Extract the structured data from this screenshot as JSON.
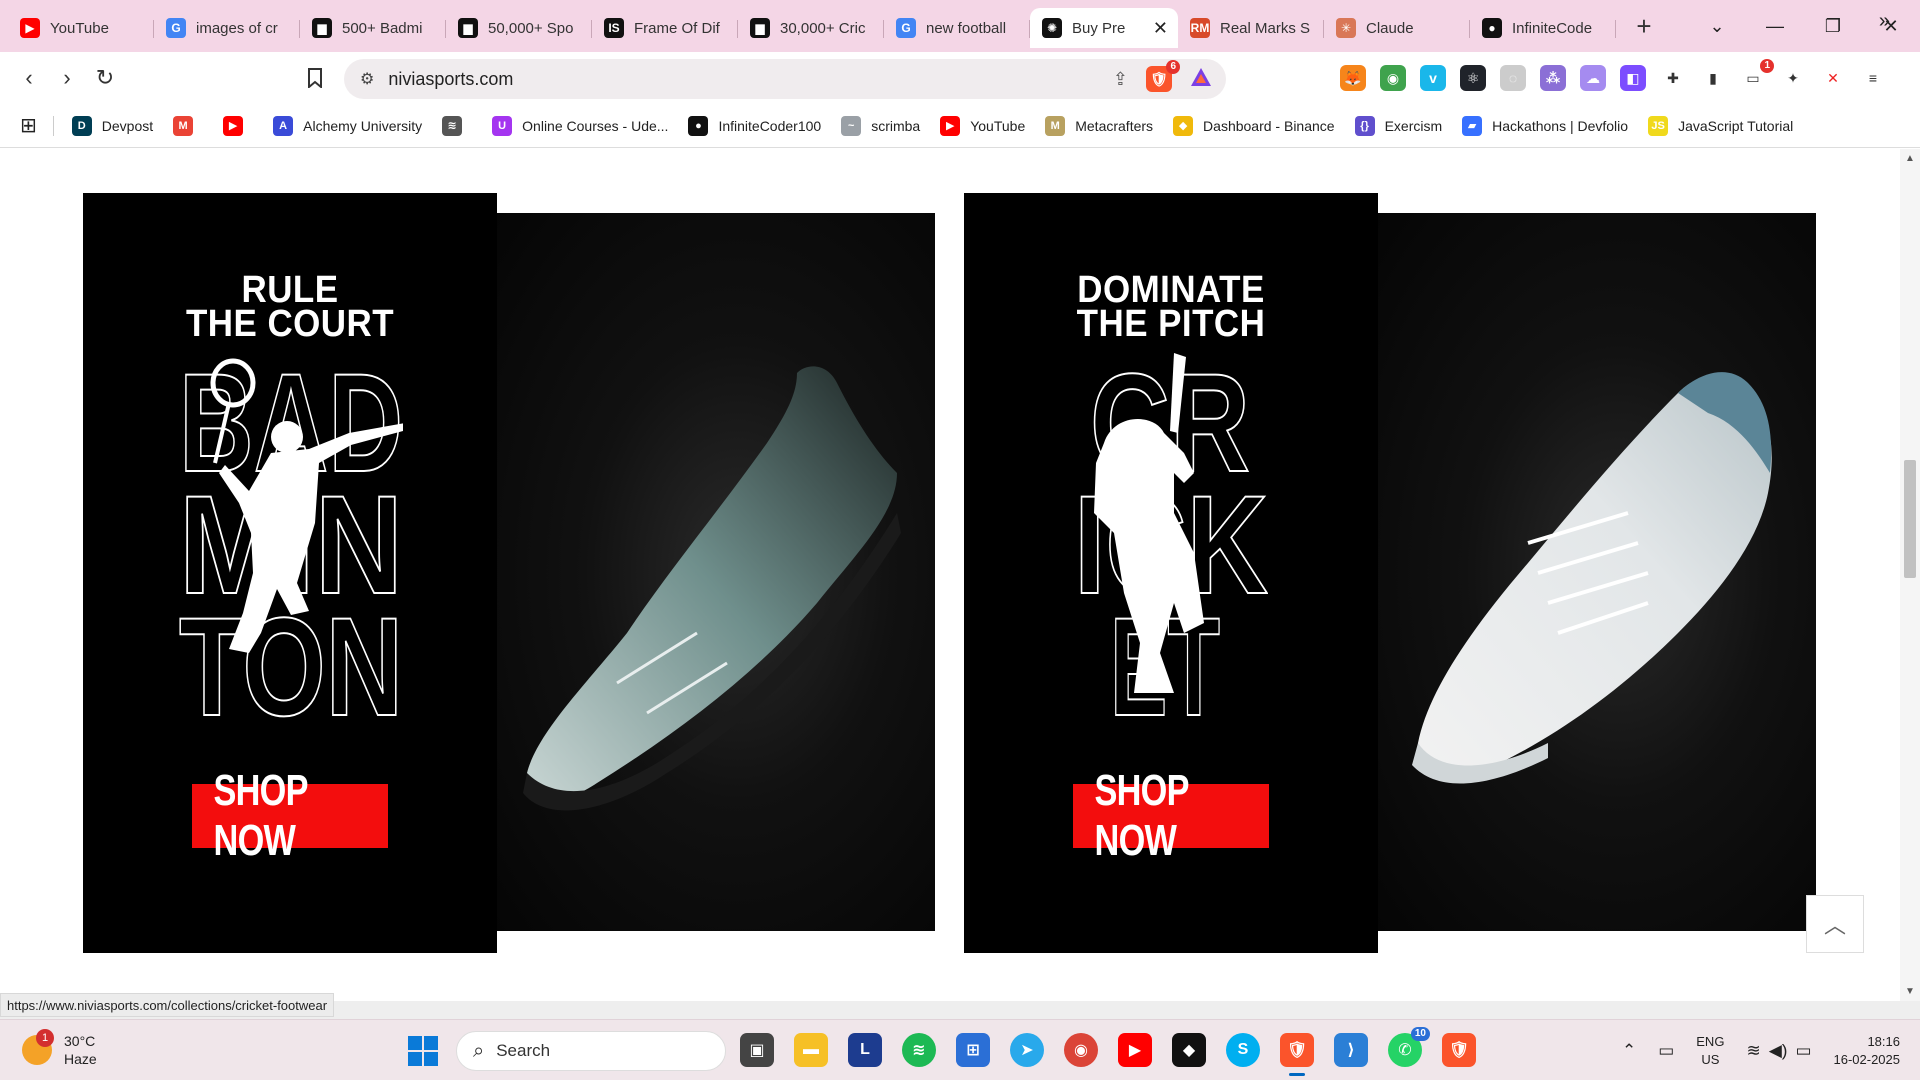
{
  "tabs": [
    {
      "label": "YouTube",
      "icon": "youtube-icon",
      "color": "#ff0000",
      "glyph": "▶"
    },
    {
      "label": "images of cr",
      "icon": "google-icon",
      "color": "#4285f4",
      "glyph": "G"
    },
    {
      "label": "500+ Badmi",
      "icon": "unsplash-icon",
      "color": "#111111",
      "glyph": "▆"
    },
    {
      "label": "50,000+ Spo",
      "icon": "unsplash-icon",
      "color": "#111111",
      "glyph": "▆"
    },
    {
      "label": "Frame Of Dif",
      "icon": "is-icon",
      "color": "#111111",
      "glyph": "IS"
    },
    {
      "label": "30,000+ Cric",
      "icon": "unsplash-icon",
      "color": "#111111",
      "glyph": "▆"
    },
    {
      "label": "new football",
      "icon": "google-icon",
      "color": "#4285f4",
      "glyph": "G"
    },
    {
      "label": "Buy Pre",
      "icon": "nivia-icon",
      "color": "#111111",
      "glyph": "✺",
      "active": true
    },
    {
      "label": "Real Marks S",
      "icon": "realmarks-icon",
      "color": "#d84a2a",
      "glyph": "RM"
    },
    {
      "label": "Claude",
      "icon": "claude-icon",
      "color": "#d97757",
      "glyph": "✳"
    },
    {
      "label": "InfiniteCode",
      "icon": "github-icon",
      "color": "#111111",
      "glyph": "●"
    }
  ],
  "window": {
    "minimize": "—",
    "restore": "❐",
    "close": "✕"
  },
  "toolbar": {
    "url": "niviasports.com",
    "brave_badge": "6",
    "ext_badge": "1"
  },
  "bookmarks": [
    {
      "label": "Devpost",
      "color": "#003e54",
      "glyph": "D"
    },
    {
      "label": "",
      "color": "#ea4335",
      "glyph": "M"
    },
    {
      "label": "",
      "color": "#ff0000",
      "glyph": "▶"
    },
    {
      "label": "Alchemy University",
      "color": "#3a4bd8",
      "glyph": "A"
    },
    {
      "label": "",
      "color": "#555555",
      "glyph": "≋"
    },
    {
      "label": "Online Courses - Ude...",
      "color": "#a435f0",
      "glyph": "U"
    },
    {
      "label": "InfiniteCoder100",
      "color": "#111111",
      "glyph": "●"
    },
    {
      "label": "scrimba",
      "color": "#9aa0a6",
      "glyph": "~"
    },
    {
      "label": "YouTube",
      "color": "#ff0000",
      "glyph": "▶"
    },
    {
      "label": "Metacrafters",
      "color": "#b8a160",
      "glyph": "M"
    },
    {
      "label": "Dashboard - Binance",
      "color": "#f0b90b",
      "glyph": "◆"
    },
    {
      "label": "Exercism",
      "color": "#604fcd",
      "glyph": "{}"
    },
    {
      "label": "Hackathons | Devfolio",
      "color": "#3770ff",
      "glyph": "▰"
    },
    {
      "label": "JavaScript Tutorial",
      "color": "#f0d91c",
      "glyph": "JS"
    }
  ],
  "page": {
    "banner1": {
      "headline_line1": "RULE",
      "headline_line2": "THE COURT",
      "sport_word": "BADMINTON",
      "button": "SHOP NOW"
    },
    "banner2": {
      "headline_line1": "DOMINATE",
      "headline_line2": "THE PITCH",
      "sport_word": "CRICKET",
      "button": "SHOP NOW"
    },
    "scroll_top": "︿",
    "status_url": "https://www.niviasports.com/collections/cricket-footwear"
  },
  "taskbar": {
    "weather_temp": "30°C",
    "weather_desc": "Haze",
    "weather_badge": "1",
    "search_placeholder": "Search",
    "whatsapp_badge": "10",
    "lang_line1": "ENG",
    "lang_line2": "US",
    "time": "18:16",
    "date": "16-02-2025"
  }
}
